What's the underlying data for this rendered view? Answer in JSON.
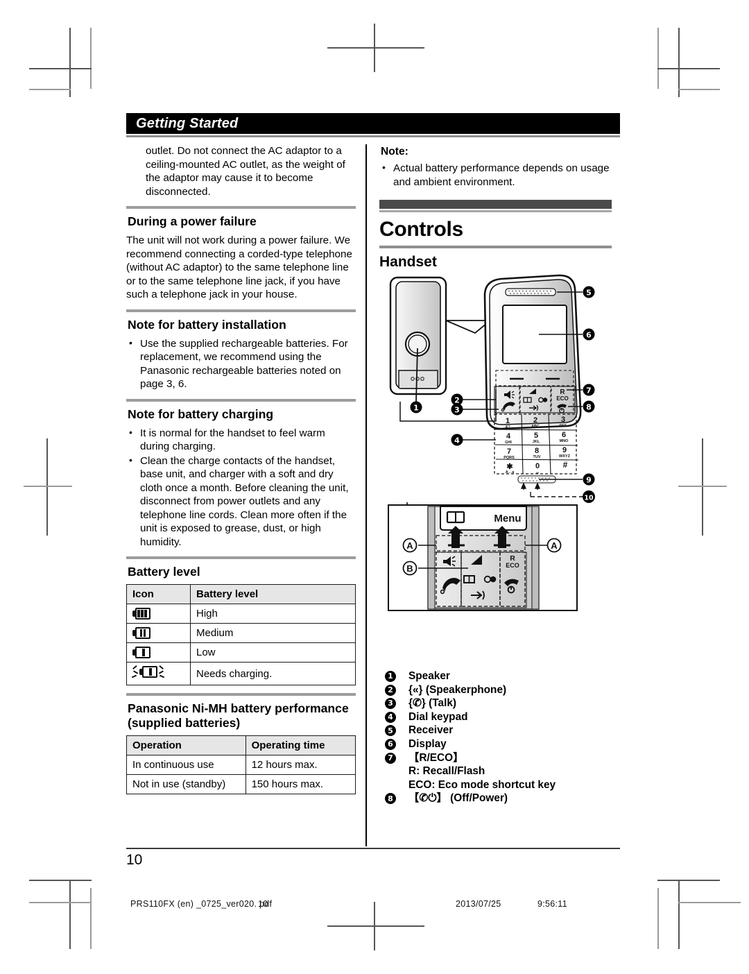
{
  "header": {
    "running_head": "Getting Started"
  },
  "left_column": {
    "intro_paragraph": "outlet. Do not connect the AC adaptor to a ceiling-mounted AC outlet, as the weight of the adaptor may cause it to become disconnected.",
    "power_failure": {
      "heading": "During a power failure",
      "body": "The unit will not work during a power failure. We recommend connecting a corded-type telephone (without AC adaptor) to the same telephone line or to the same telephone line jack, if you have such a telephone jack in your house."
    },
    "battery_installation": {
      "heading": "Note for battery installation",
      "bullets": [
        "Use the supplied rechargeable batteries. For replacement, we recommend using the Panasonic rechargeable batteries noted on page 3, 6."
      ]
    },
    "battery_charging": {
      "heading": "Note for battery charging",
      "bullets": [
        "It is normal for the handset to feel warm during charging.",
        "Clean the charge contacts of the handset, base unit, and charger with a soft and dry cloth once a month. Before cleaning the unit, disconnect from power outlets and any telephone line cords. Clean more often if the unit is exposed to grease, dust, or high humidity."
      ]
    },
    "battery_level": {
      "heading": "Battery level",
      "columns": [
        "Icon",
        "Battery level"
      ],
      "rows": [
        {
          "icon": "battery-high-icon",
          "level": "High"
        },
        {
          "icon": "battery-medium-icon",
          "level": "Medium"
        },
        {
          "icon": "battery-low-icon",
          "level": "Low"
        },
        {
          "icon": "battery-empty-flashing-icon",
          "level": "Needs charging."
        }
      ]
    },
    "battery_performance": {
      "heading": "Panasonic Ni-MH battery performance (supplied batteries)",
      "columns": [
        "Operation",
        "Operating time"
      ],
      "rows": [
        {
          "operation": "In continuous use",
          "time": "12 hours max."
        },
        {
          "operation": "Not in use (standby)",
          "time": "150 hours max."
        }
      ]
    }
  },
  "right_column": {
    "note": {
      "heading": "Note:",
      "bullets": [
        "Actual battery performance depends on usage and ambient environment."
      ]
    },
    "chapter_title": "Controls",
    "section_title": "Handset",
    "figure": {
      "callouts": [
        "1",
        "2",
        "3",
        "4",
        "5",
        "6",
        "7",
        "8",
        "9",
        "10"
      ],
      "detail_callouts": [
        "A",
        "A",
        "B"
      ],
      "softkey_labels": {
        "phonebook": "phonebook-icon",
        "menu": "Menu"
      },
      "key_labels": {
        "r_eco_top": "R",
        "r_eco_bottom": "ECO"
      },
      "keypad": [
        {
          "digit": "1",
          "letters": "&'!"
        },
        {
          "digit": "2",
          "letters": "ABC"
        },
        {
          "digit": "3",
          "letters": "DEF"
        },
        {
          "digit": "4",
          "letters": "GHI"
        },
        {
          "digit": "5",
          "letters": "JKL"
        },
        {
          "digit": "6",
          "letters": "MNO"
        },
        {
          "digit": "7",
          "letters": "PQRS"
        },
        {
          "digit": "8",
          "letters": "TUV"
        },
        {
          "digit": "9",
          "letters": "WXYZ"
        },
        {
          "digit": "✱",
          "letters": "A↔a"
        },
        {
          "digit": "0",
          "letters": "␣"
        },
        {
          "digit": "#",
          "letters": ""
        }
      ]
    },
    "legend": [
      {
        "num": "1",
        "text": "Speaker"
      },
      {
        "num": "2",
        "text": "{«} (Speakerphone)"
      },
      {
        "num": "3",
        "text": "{✆} (Talk)"
      },
      {
        "num": "4",
        "text": "Dial keypad"
      },
      {
        "num": "5",
        "text": "Receiver"
      },
      {
        "num": "6",
        "text": "Display"
      },
      {
        "num": "7",
        "text": "【R/ECO】"
      },
      {
        "num": "8",
        "text": "【✆⏻】 (Off/Power)"
      }
    ],
    "legend_sublines": [
      "R: Recall/Flash",
      "ECO: Eco mode shortcut key"
    ]
  },
  "footer": {
    "page_number": "10",
    "file_name": "PRS110FX (en) _0725_ver020. pdf",
    "print_page": "10",
    "date": "2013/07/25",
    "time": "9:56:11"
  }
}
